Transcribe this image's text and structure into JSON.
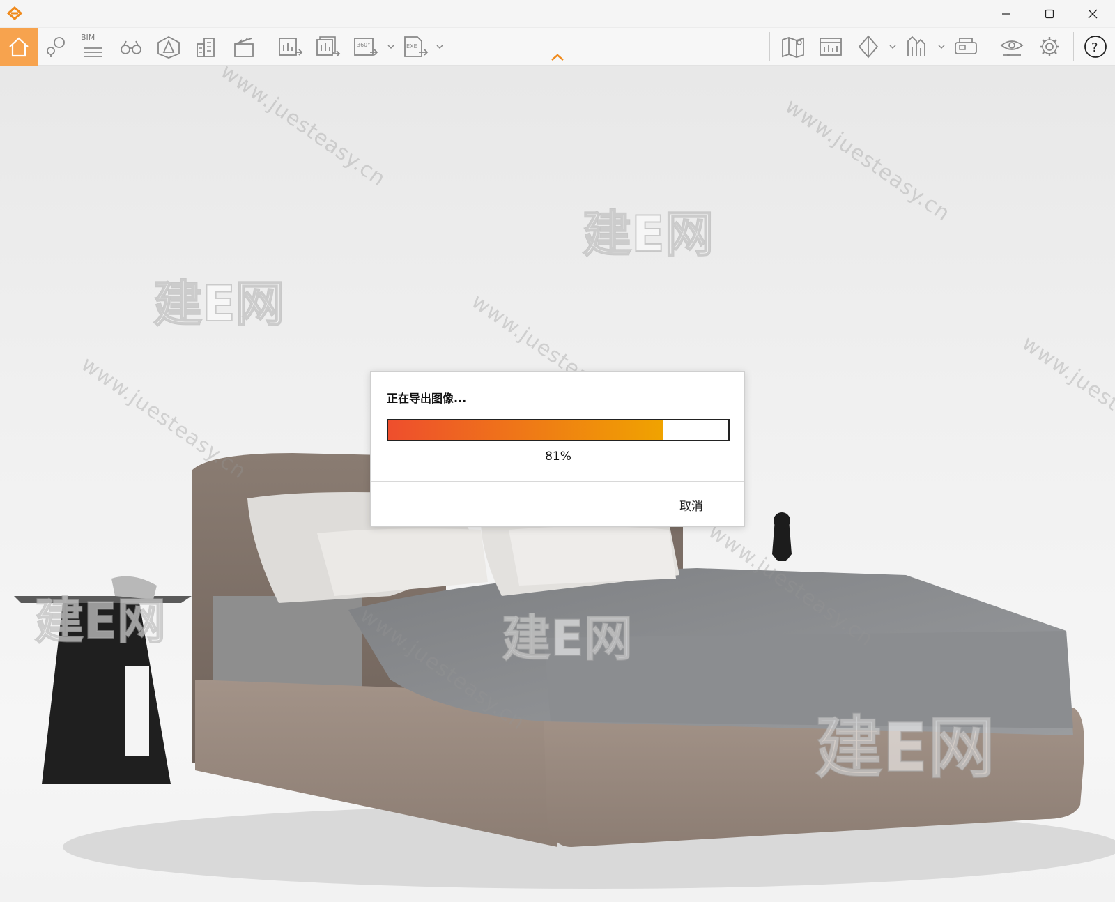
{
  "window": {
    "minimize_label": "",
    "maximize_label": "",
    "close_label": ""
  },
  "toolbar": {
    "bim_label": "BIM",
    "accent_color": "#f7a34e",
    "tools_left": [
      {
        "name": "home-icon"
      },
      {
        "name": "location-pin-icon"
      },
      {
        "name": "bim-icon"
      },
      {
        "name": "binoculars-icon"
      },
      {
        "name": "perspective-icon"
      },
      {
        "name": "buildings-icon"
      },
      {
        "name": "clapperboard-icon"
      }
    ],
    "tools_export": [
      {
        "name": "export-image-icon"
      },
      {
        "name": "export-batch-icon"
      },
      {
        "name": "export-360-icon",
        "label": "360°"
      },
      {
        "name": "export-exe-icon",
        "label": "EXE"
      }
    ],
    "tools_right": [
      {
        "name": "map-icon"
      },
      {
        "name": "screen-icon"
      },
      {
        "name": "section-icon"
      },
      {
        "name": "rooms-icon"
      },
      {
        "name": "vr-icon"
      },
      {
        "name": "eye-icon"
      },
      {
        "name": "gear-icon"
      },
      {
        "name": "help-icon",
        "label": "?"
      }
    ]
  },
  "watermarks": {
    "brand": "建E网",
    "url": "www.juesteasy.cn"
  },
  "dialog": {
    "title": "正在导出图像...",
    "progress": 0.81,
    "progress_text": "81%",
    "cancel_label": "取消",
    "gradient_start": "#ee4e2d",
    "gradient_end": "#f0a300"
  }
}
